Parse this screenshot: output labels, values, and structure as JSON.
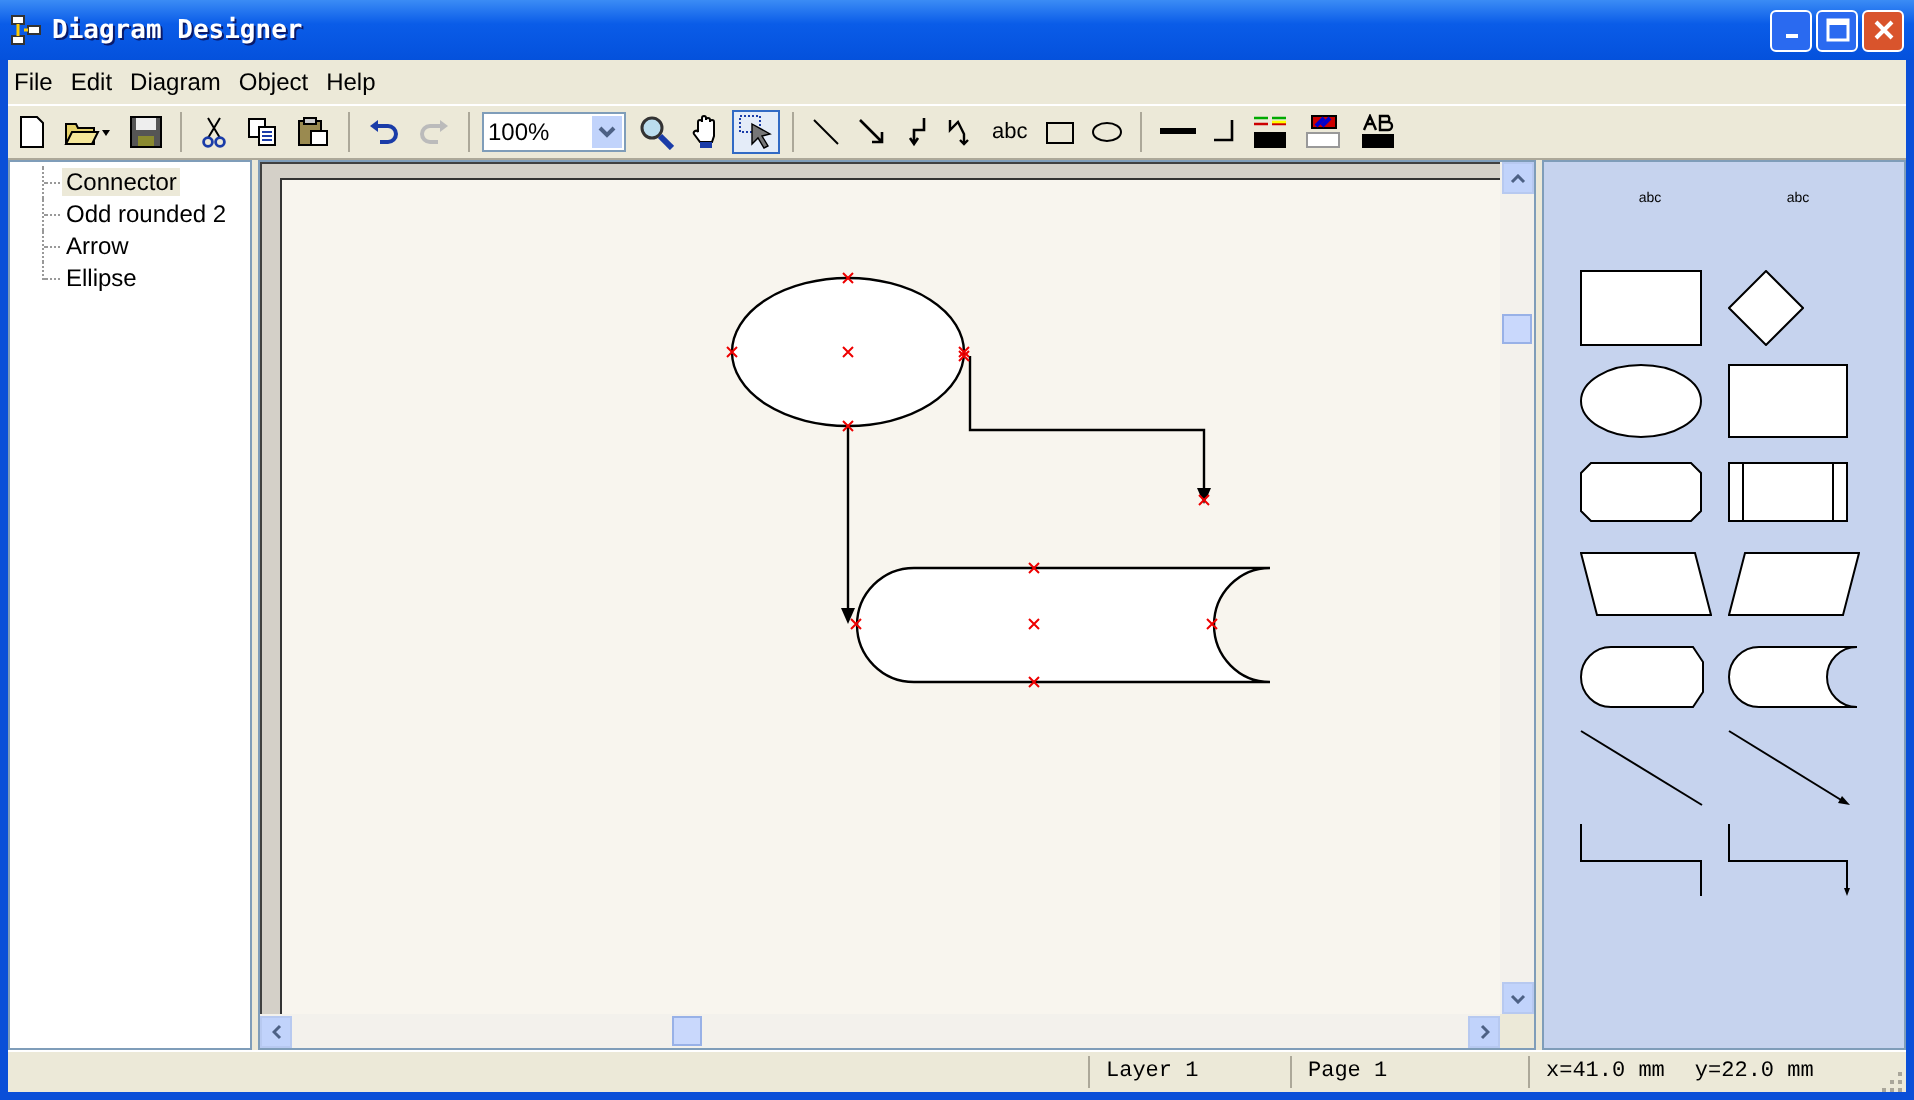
{
  "window": {
    "title": "Diagram Designer"
  },
  "menu": [
    "File",
    "Edit",
    "Diagram",
    "Object",
    "Help"
  ],
  "toolbar": {
    "zoom": "100%",
    "text_tool": "abc",
    "select_selected": true
  },
  "tree": [
    {
      "label": "Connector",
      "selected": true
    },
    {
      "label": "Odd rounded 2",
      "selected": false
    },
    {
      "label": "Arrow",
      "selected": false
    },
    {
      "label": "Ellipse",
      "selected": false
    }
  ],
  "palette": {
    "labels": [
      "abc",
      "abc"
    ]
  },
  "status_bar": {
    "layer": "Layer 1",
    "page": "Page 1",
    "x": "x=41.0 mm",
    "y": "y=22.0 mm"
  }
}
